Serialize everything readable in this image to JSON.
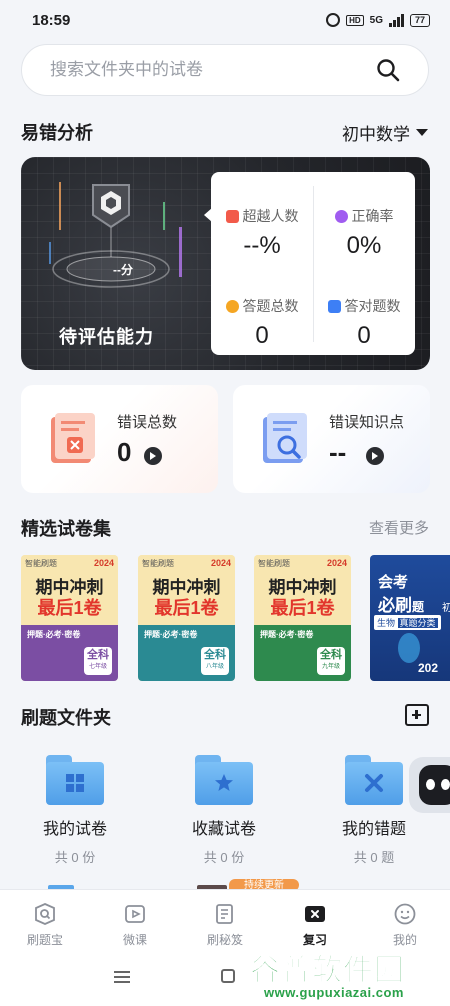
{
  "status_bar": {
    "time": "18:59",
    "network": "5G",
    "battery": "77"
  },
  "search": {
    "placeholder": "搜索文件夹中的试卷"
  },
  "analysis": {
    "title": "易错分析",
    "subject": "初中数学",
    "ability_label": "待评估能力",
    "ability_score": "--分",
    "stats": [
      {
        "label": "超越人数",
        "value": "--%",
        "icon": "trend-icon",
        "color": "#f25a4a"
      },
      {
        "label": "正确率",
        "value": "0%",
        "icon": "check-circle-icon",
        "color": "#a05cf0"
      },
      {
        "label": "答题总数",
        "value": "0",
        "icon": "medal-icon",
        "color": "#f5a623"
      },
      {
        "label": "答对题数",
        "value": "0",
        "icon": "clipboard-check-icon",
        "color": "#3d7ff5"
      }
    ]
  },
  "errors": {
    "total_label": "错误总数",
    "total_value": "0",
    "points_label": "错误知识点",
    "points_value": "--"
  },
  "papers": {
    "title": "精选试卷集",
    "more": "查看更多",
    "books": [
      {
        "brand": "智能刷题",
        "year": "2024",
        "line1": "期中冲刺",
        "line2": "最后1卷",
        "tags": "押题·必考·密卷",
        "subject": "全科",
        "grade": "七年级",
        "color": "#7b4ea3"
      },
      {
        "brand": "智能刷题",
        "year": "2024",
        "line1": "期中冲刺",
        "line2": "最后1卷",
        "tags": "押题·必考·密卷",
        "subject": "全科",
        "grade": "八年级",
        "color": "#2a8a93"
      },
      {
        "brand": "智能刷题",
        "year": "2024",
        "line1": "期中冲刺",
        "line2": "最后1卷",
        "tags": "押题·必考·密卷",
        "subject": "全科",
        "grade": "九年级",
        "color": "#2e8a4e"
      }
    ],
    "book4": {
      "line1": "会考",
      "line2": "必刷",
      "line3": "题",
      "tag": "生物",
      "tag2": "真题分类",
      "side": "初",
      "year": "202"
    }
  },
  "folders": {
    "title": "刷题文件夹",
    "items": [
      {
        "name": "我的试卷",
        "count": "共 0 份"
      },
      {
        "name": "收藏试卷",
        "count": "共 0 份"
      },
      {
        "name": "我的错题",
        "count": "共 0 题"
      }
    ]
  },
  "peek": {
    "badge": "持续更新"
  },
  "tabs": [
    {
      "label": "刷题宝"
    },
    {
      "label": "微课"
    },
    {
      "label": "刷秘笈"
    },
    {
      "label": "复习"
    },
    {
      "label": "我的"
    }
  ],
  "watermark": {
    "title": "谷普软件园",
    "url": "www.gupuxiazai.com"
  }
}
